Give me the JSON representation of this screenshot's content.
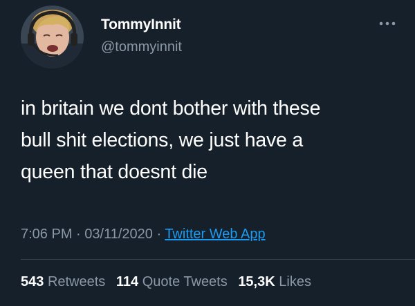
{
  "tweet": {
    "author": {
      "display_name": "TommyInnit",
      "handle": "@tommyinnit",
      "avatar_icon": "avatar-photo"
    },
    "more_icon": "more-horizontal-icon",
    "text_lines": [
      "in britain we dont bother with these",
      "bull shit elections, we just have a",
      "queen that doesnt die"
    ],
    "meta": {
      "time": "7:06 PM",
      "separator": " · ",
      "date": "03/11/2020",
      "source": "Twitter Web App"
    },
    "stats": {
      "retweets_count": "543",
      "retweets_label": "Retweets",
      "quote_tweets_count": "114",
      "quote_tweets_label": "Quote Tweets",
      "likes_count": "15,3K",
      "likes_label": "Likes"
    }
  },
  "colors": {
    "background": "#15202b",
    "text": "#ffffff",
    "secondary_text": "#8b98a5",
    "link": "#1d9bf0",
    "divider": "#38444d"
  }
}
